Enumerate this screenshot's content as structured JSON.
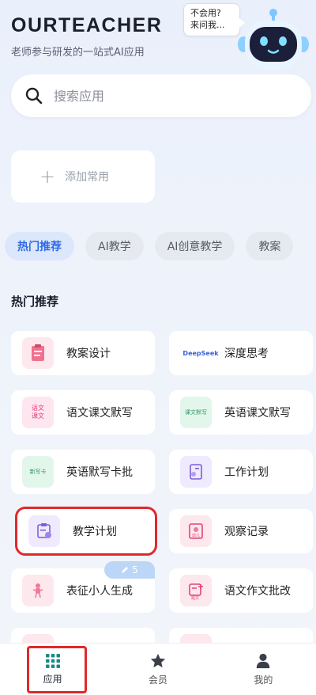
{
  "header": {
    "brand": "OURTEACHER",
    "subtitle": "老师参与研发的一站式AI应用"
  },
  "mascot": {
    "bubble_line1": "不会用?",
    "bubble_line2": "来问我..."
  },
  "search": {
    "placeholder": "搜索应用"
  },
  "favorites": {
    "add_label": "添加常用"
  },
  "tabs": [
    {
      "label": "热门推荐",
      "active": true
    },
    {
      "label": "AI教学",
      "active": false
    },
    {
      "label": "AI创意教学",
      "active": false
    },
    {
      "label": "教案",
      "active": false
    }
  ],
  "section": {
    "title": "热门推荐"
  },
  "apps": [
    {
      "label": "教案设计",
      "icon": "clipboard-icon"
    },
    {
      "label": "深度思考",
      "icon": "deepseek-logo-icon",
      "icon_text": "DeepSeek"
    },
    {
      "label": "语文课文默写",
      "icon": "chinese-text-icon",
      "icon_text": "语文课文"
    },
    {
      "label": "英语课文默写",
      "icon": "english-text-icon",
      "icon_text": "课文默写"
    },
    {
      "label": "英语默写卡批",
      "icon": "dictation-card-icon",
      "icon_text": "新写卡"
    },
    {
      "label": "工作计划",
      "icon": "work-plan-icon"
    },
    {
      "label": "教学计划",
      "icon": "teaching-plan-icon"
    },
    {
      "label": "观察记录",
      "icon": "observation-icon",
      "icon_text": "幼儿"
    },
    {
      "label": "表征小人生成",
      "icon": "figure-icon"
    },
    {
      "label": "语文作文批改",
      "icon": "essay-icon",
      "icon_text": "题文"
    }
  ],
  "badge": {
    "count": "5"
  },
  "tabbar": [
    {
      "label": "应用",
      "icon": "grid-icon",
      "active": true
    },
    {
      "label": "会员",
      "icon": "star-icon",
      "active": false
    },
    {
      "label": "我的",
      "icon": "user-icon",
      "active": false
    }
  ]
}
